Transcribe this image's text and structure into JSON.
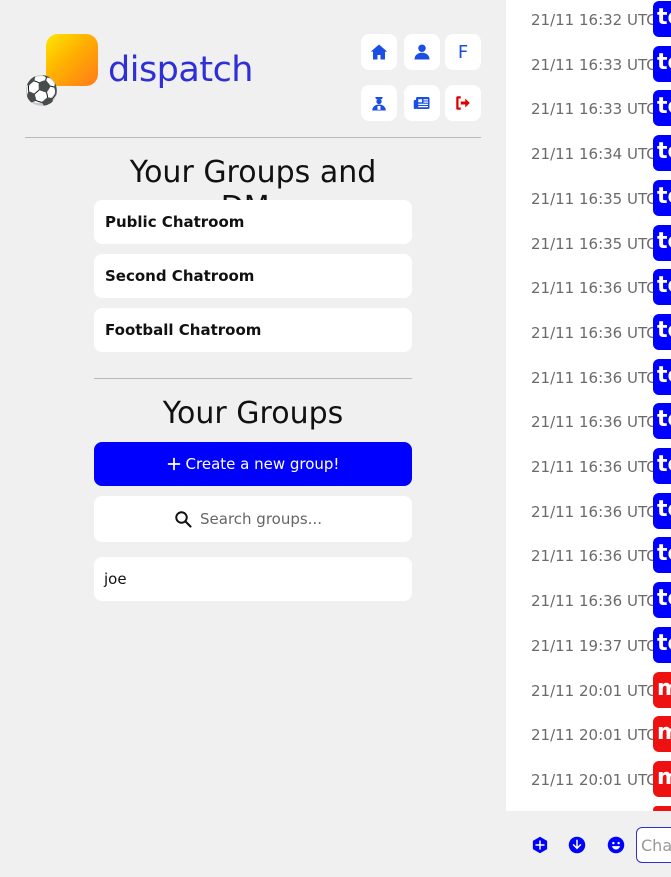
{
  "brand": {
    "name": "dispatch",
    "badge_emoji": "⚽"
  },
  "header_icons": {
    "home": "home-icon",
    "profile": "user-icon",
    "profile_initial": "F",
    "admin": "admin-user-icon",
    "news": "newspaper-icon",
    "logout": "logout-icon"
  },
  "sections": {
    "groups_dms_title": "Your Groups and DMs",
    "groups_title": "Your Groups"
  },
  "chatrooms": [
    {
      "label": "Public Chatroom"
    },
    {
      "label": "Second Chatroom"
    },
    {
      "label": "Football Chatroom"
    }
  ],
  "create_group": {
    "label": "Create a new group!",
    "icon": "plus-icon"
  },
  "search": {
    "placeholder": "Search groups...",
    "value": ""
  },
  "groups": [
    {
      "label": "joe"
    }
  ],
  "messages": [
    {
      "time": "21/11 16:32 UTC",
      "author": "te",
      "color": "#0000ff"
    },
    {
      "time": "21/11 16:33 UTC",
      "author": "te",
      "color": "#0000ff"
    },
    {
      "time": "21/11 16:33 UTC",
      "author": "te",
      "color": "#0000ff"
    },
    {
      "time": "21/11 16:34 UTC",
      "author": "te",
      "color": "#0000ff"
    },
    {
      "time": "21/11 16:35 UTC",
      "author": "te",
      "color": "#0000ff"
    },
    {
      "time": "21/11 16:35 UTC",
      "author": "te",
      "color": "#0000ff"
    },
    {
      "time": "21/11 16:36 UTC",
      "author": "te",
      "color": "#0000ff"
    },
    {
      "time": "21/11 16:36 UTC",
      "author": "te",
      "color": "#0000ff"
    },
    {
      "time": "21/11 16:36 UTC",
      "author": "te",
      "color": "#0000ff"
    },
    {
      "time": "21/11 16:36 UTC",
      "author": "te",
      "color": "#0000ff"
    },
    {
      "time": "21/11 16:36 UTC",
      "author": "te",
      "color": "#0000ff"
    },
    {
      "time": "21/11 16:36 UTC",
      "author": "te",
      "color": "#0000ff"
    },
    {
      "time": "21/11 16:36 UTC",
      "author": "te",
      "color": "#0000ff"
    },
    {
      "time": "21/11 16:36 UTC",
      "author": "te",
      "color": "#0000ff"
    },
    {
      "time": "21/11 19:37 UTC",
      "author": "te",
      "color": "#0000ff"
    },
    {
      "time": "21/11 20:01 UTC",
      "author": "m",
      "color": "#ee1111"
    },
    {
      "time": "21/11 20:01 UTC",
      "author": "m",
      "color": "#ee1111"
    },
    {
      "time": "21/11 20:01 UTC",
      "author": "m",
      "color": "#ee1111"
    }
  ],
  "composer": {
    "placeholder": "Chat",
    "icons": [
      "plus-circle-icon",
      "arrow-down-circle-icon",
      "smiley-icon"
    ]
  },
  "colors": {
    "accent": "#0000ff",
    "brand_text": "#2f2fd6",
    "danger": "#ee1111",
    "background": "#f0f0f0"
  }
}
